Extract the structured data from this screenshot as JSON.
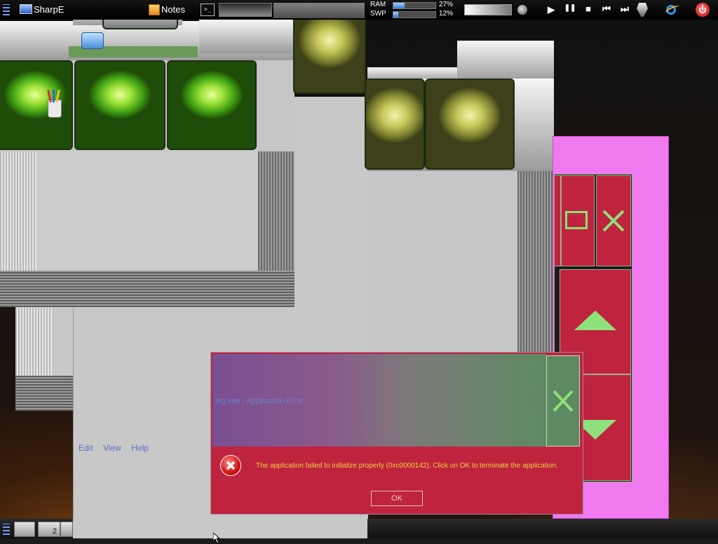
{
  "topbar": {
    "start_label": "SharpE",
    "notes_label": "Notes",
    "terminal_glyph": ">_",
    "ram_label": "RAM",
    "ram_value": "27%",
    "ram_fraction": 0.27,
    "swap_label": "SWP",
    "swap_value": "12%",
    "swap_fraction": 0.12,
    "media": {
      "play": "▶",
      "pause": "❚❚",
      "stop": "■",
      "prev": "⏮",
      "next": "⏭"
    },
    "icons": [
      "menu-grip-icon",
      "monitor-icon",
      "notes-icon",
      "terminal-icon",
      "volume-icon",
      "play-icon",
      "pause-icon",
      "stop-icon",
      "previous-icon",
      "next-icon",
      "hardware-icon",
      "internet-explorer-icon",
      "power-icon"
    ]
  },
  "menu": {
    "edit": "Edit",
    "view": "View",
    "help": "Help"
  },
  "dialog": {
    "title": "ieg.exe - Application Error",
    "message": "The application failed to initialize properly (0xc0000142). Click on OK to terminate the application.",
    "ok_label": "OK",
    "icons": [
      "error-icon",
      "close-icon"
    ]
  },
  "bottombar": {
    "desktop_number": "2",
    "icons": [
      "menu-grip-icon",
      "window-list-icon"
    ]
  },
  "colors": {
    "crimson": "#c0233e",
    "pink": "#f079f0",
    "arrow_green": "#8ee07a",
    "title_purple": "#7a4f93",
    "title_green": "#5e8a62",
    "message_text": "#e8d43c",
    "link_blue": "#5a70c8",
    "orb_green": "#9fe43a",
    "orb_olive": "#c6c85a"
  }
}
